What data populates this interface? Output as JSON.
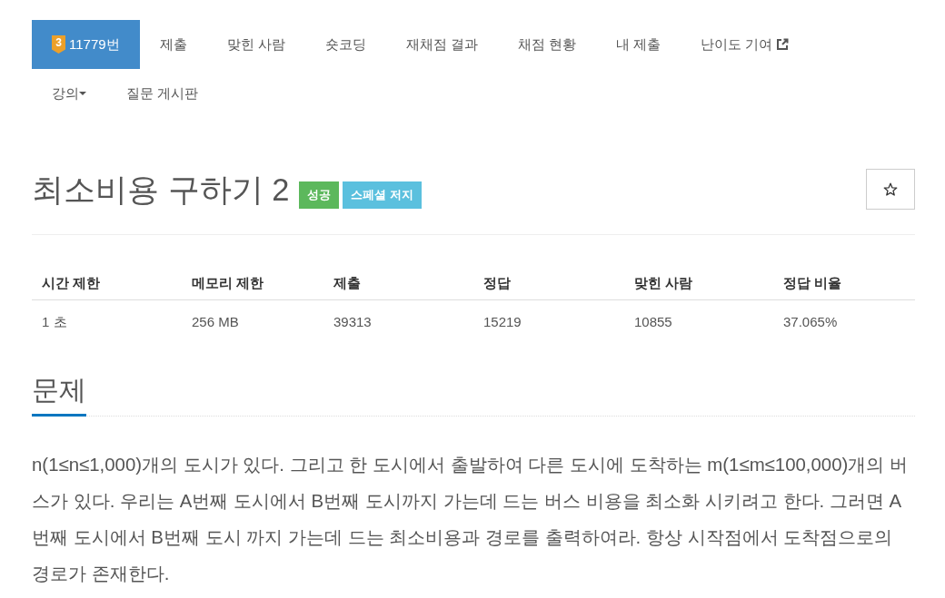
{
  "nav": {
    "items": [
      {
        "kind": "problem",
        "tier": "3",
        "label": "11779번",
        "selected": true
      },
      {
        "kind": "link",
        "label": "제출",
        "selected": false
      },
      {
        "kind": "link",
        "label": "맞힌 사람",
        "selected": false
      },
      {
        "kind": "link",
        "label": "숏코딩",
        "selected": false
      },
      {
        "kind": "link",
        "label": "재채점 결과",
        "selected": false
      },
      {
        "kind": "link",
        "label": "채점 현황",
        "selected": false
      },
      {
        "kind": "link",
        "label": "내 제출",
        "selected": false
      },
      {
        "kind": "external",
        "label": "난이도 기여",
        "selected": false
      },
      {
        "kind": "dropdown",
        "label": "강의",
        "selected": false
      },
      {
        "kind": "link",
        "label": "질문 게시판",
        "selected": false
      }
    ]
  },
  "problem": {
    "title": "최소비용 구하기 2",
    "labels": [
      {
        "text": "성공",
        "color": "#5cb85c"
      },
      {
        "text": "스페셜 저지",
        "color": "#5bc0de"
      }
    ]
  },
  "info_table": {
    "columns": [
      "시간 제한",
      "메모리 제한",
      "제출",
      "정답",
      "맞힌 사람",
      "정답 비율"
    ],
    "rows": [
      [
        "1 초",
        "256 MB",
        "39313",
        "15219",
        "10855",
        "37.065%"
      ]
    ]
  },
  "section": {
    "heading": "문제",
    "text": "n(1≤n≤1,000)개의 도시가 있다. 그리고 한 도시에서 출발하여 다른 도시에 도착하는 m(1≤m≤100,000)개의 버스가 있다. 우리는 A번째 도시에서 B번째 도시까지 가는데 드는 버스 비용을 최소화 시키려고 한다. 그러면 A번째 도시에서 B번째 도시 까지 가는데 드는 최소비용과 경로를 출력하여라. 항상 시작점에서 도착점으로의 경로가 존재한다."
  }
}
